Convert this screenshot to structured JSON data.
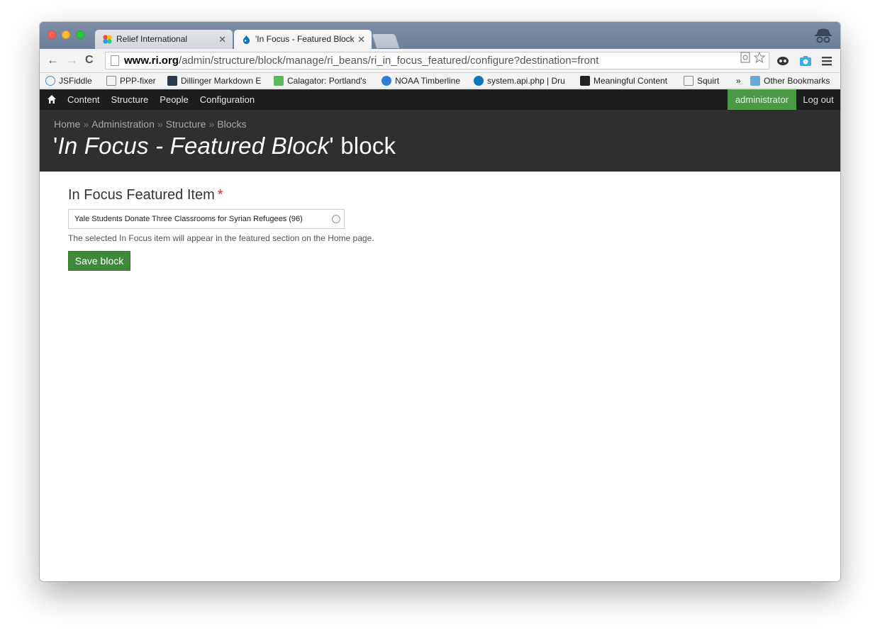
{
  "browser": {
    "tabs": [
      {
        "title": "Relief International",
        "active": false
      },
      {
        "title": "'In Focus - Featured Block'",
        "active": true
      }
    ],
    "url": {
      "host": "www.ri.org",
      "path": "/admin/structure/block/manage/ri_beans/ri_in_focus_featured/configure?destination=front"
    },
    "bookmarks": [
      {
        "label": "JSFiddle"
      },
      {
        "label": "PPP-fixer"
      },
      {
        "label": "Dillinger Markdown E"
      },
      {
        "label": "Calagator: Portland's"
      },
      {
        "label": "NOAA Timberline"
      },
      {
        "label": "system.api.php | Dru"
      },
      {
        "label": "Meaningful Content"
      },
      {
        "label": "Squirt"
      },
      {
        "label": "»"
      },
      {
        "label": "Other Bookmarks"
      }
    ]
  },
  "admin_toolbar": {
    "menu": [
      "Content",
      "Structure",
      "People",
      "Configuration"
    ],
    "user": "administrator",
    "logout": "Log out",
    "accent_color": "#4a9a45"
  },
  "page": {
    "breadcrumb": [
      "Home",
      "Administration",
      "Structure",
      "Blocks"
    ],
    "breadcrumb_sep": "»",
    "title_prefix": "'",
    "title_italic": "In Focus - Featured Block",
    "title_suffix": "' block"
  },
  "form": {
    "label": "In Focus Featured Item",
    "required_mark": "*",
    "value": "Yale Students Donate Three Classrooms for Syrian Refugees (96)",
    "help": "The selected In Focus item will appear in the featured section on the Home page.",
    "submit": "Save block"
  }
}
